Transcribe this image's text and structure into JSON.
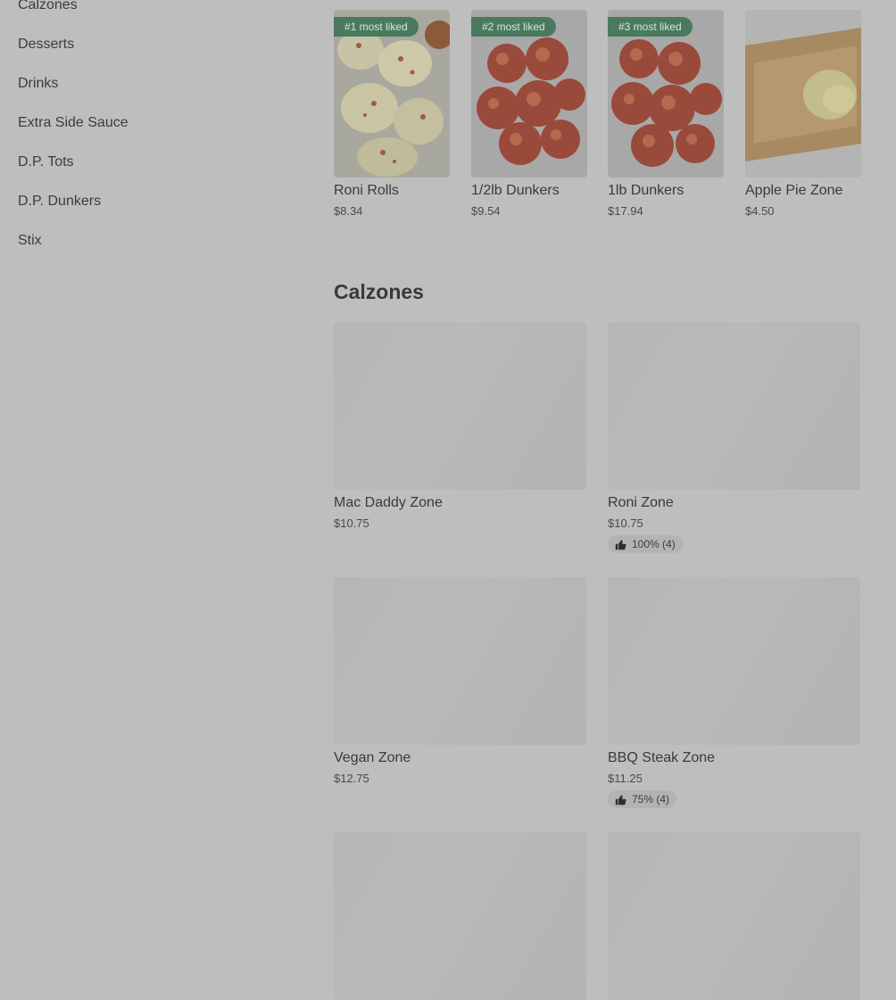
{
  "sidebar": {
    "items": [
      {
        "label": "Calzones"
      },
      {
        "label": "Desserts"
      },
      {
        "label": "Drinks"
      },
      {
        "label": "Extra Side Sauce"
      },
      {
        "label": "D.P. Tots"
      },
      {
        "label": "D.P. Dunkers"
      },
      {
        "label": "Stix"
      }
    ]
  },
  "popular": [
    {
      "badge": "#1 most liked",
      "name": "Roni Rolls",
      "price": "$8.34"
    },
    {
      "badge": "#2 most liked",
      "name": "1/2lb Dunkers",
      "price": "$9.54"
    },
    {
      "badge": "#3 most liked",
      "name": "1lb Dunkers",
      "price": "$17.94"
    },
    {
      "name": "Apple Pie Zone",
      "price": "$4.50"
    }
  ],
  "section": {
    "title": "Calzones"
  },
  "calzones": [
    {
      "name": "Mac Daddy Zone",
      "price": "$10.75"
    },
    {
      "name": "Roni Zone",
      "price": "$10.75",
      "rating": "100% (4)"
    },
    {
      "name": "Vegan Zone",
      "price": "$12.75"
    },
    {
      "name": "BBQ Steak Zone",
      "price": "$11.25",
      "rating": "75% (4)"
    }
  ],
  "colors": {
    "overlay_bg": "#bebebe",
    "badge_bg": "#4a7a5e",
    "image_placeholder": "#b6b6b6"
  }
}
